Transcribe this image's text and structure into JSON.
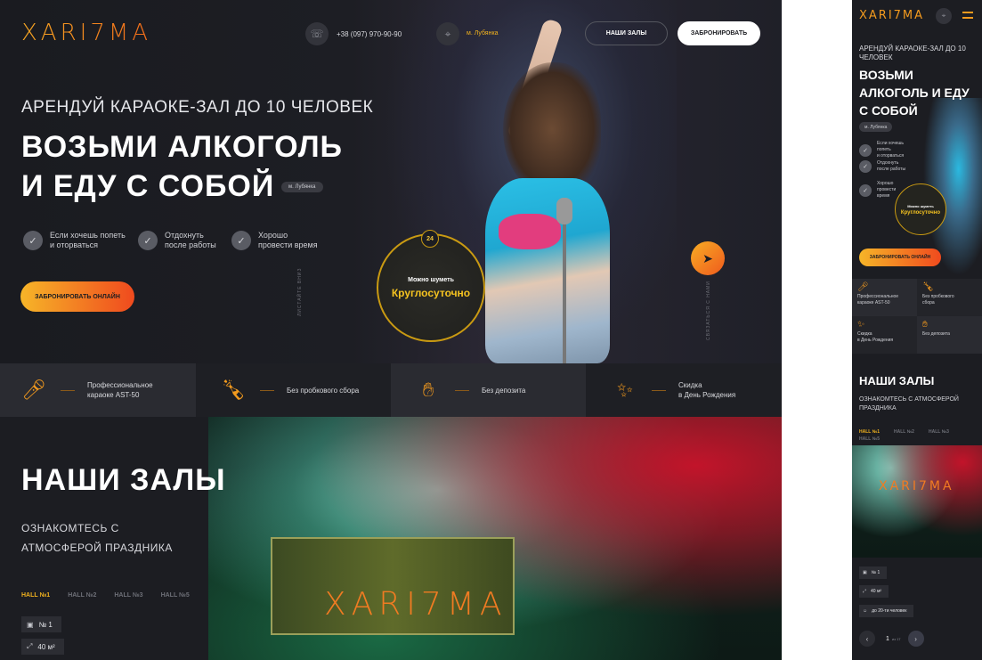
{
  "desktop": {
    "logo": "XARI7MA",
    "header": {
      "phone": "+38 (097) 970-90-90",
      "metro": "м. Лубянка",
      "halls_button": "НАШИ ЗАЛЫ",
      "book_button": "ЗАБРОНИРОВАТЬ"
    },
    "hero": {
      "subtitle": "АРЕНДУЙ КАРАОКЕ-ЗАЛ ДО 10 ЧЕЛОВЕК",
      "title_line1": "ВОЗЬМИ АЛКОГОЛЬ",
      "title_line2": "И ЕДУ С СОБОЙ",
      "metro_pill": "м. Лубянка",
      "features": [
        {
          "line1": "Если хочешь попеть",
          "line2": "и оторваться"
        },
        {
          "line1": "Отдохнуть",
          "line2": "после работы"
        },
        {
          "line1": "Хорошо",
          "line2": "провести время"
        }
      ],
      "cta": "ЗАБРОНИРОВАТЬ ОНЛАЙН",
      "vertical_left": "ЛИСТАЙТЕ ВНИЗ",
      "vertical_right": "СВЯЗАТЬСЯ С НАМИ",
      "badge_hours": "24",
      "badge_small": "Можно шуметь",
      "badge_big": "Круглосуточно"
    },
    "strip": [
      {
        "line1": "Профессиональное",
        "line2": "караоке AST-50",
        "icon": "microphone-icon"
      },
      {
        "line1": "Без пробкового сбора",
        "line2": "",
        "icon": "champagne-icon"
      },
      {
        "line1": "Без депозита",
        "line2": "",
        "icon": "money-hand-icon"
      },
      {
        "line1": "Скидка",
        "line2": "в День Рождения",
        "icon": "confetti-icon"
      }
    ],
    "halls": {
      "title": "НАШИ ЗАЛЫ",
      "subtitle": "ОЗНАКОМТЕСЬ С АТМОСФЕРОЙ ПРАЗДНИКА",
      "tabs": [
        "HALL №1",
        "HALL №2",
        "HALL №3",
        "HALL №5"
      ],
      "active_tab": 0,
      "specs": [
        "№ 1",
        "40 м²"
      ],
      "photo_logo": "XARI7MA"
    }
  },
  "mobile": {
    "logo": "XARI7MA",
    "subtitle": "АРЕНДУЙ КАРАОКЕ-ЗАЛ ДО 10 ЧЕЛОВЕК",
    "title": "ВОЗЬМИ АЛКОГОЛЬ И ЕДУ С СОБОЙ",
    "metro_pill": "м. Лубянка",
    "features": [
      {
        "line1": "Если хочешь попеть",
        "line2": "и оторваться"
      },
      {
        "line1": "Отдохнуть",
        "line2": "после работы"
      },
      {
        "line1": "Хорошо",
        "line2": "провести время"
      }
    ],
    "badge_small": "Можно шуметь",
    "badge_big": "Круглосуточно",
    "cta": "ЗАБРОНИРОВАТЬ ОНЛАЙН",
    "grid": [
      {
        "line1": "Профессиональное",
        "line2": "караоке AST-50"
      },
      {
        "line1": "Без пробкового",
        "line2": "сбора"
      },
      {
        "line1": "Скидка",
        "line2": "в День Рождения"
      },
      {
        "line1": "Без депозита",
        "line2": ""
      }
    ],
    "halls_title": "НАШИ ЗАЛЫ",
    "halls_subtitle": "ОЗНАКОМТЕСЬ С АТМОСФЕРОЙ ПРАЗДНИКА",
    "tabs": [
      "HALL №1",
      "HALL №2",
      "HALL №3",
      "HALL №5"
    ],
    "photo_logo": "XARI7MA",
    "specs": [
      "№ 1",
      "40 м²",
      "до 20-ти человек"
    ],
    "pager_current": "1",
    "pager_total": "из 17"
  }
}
